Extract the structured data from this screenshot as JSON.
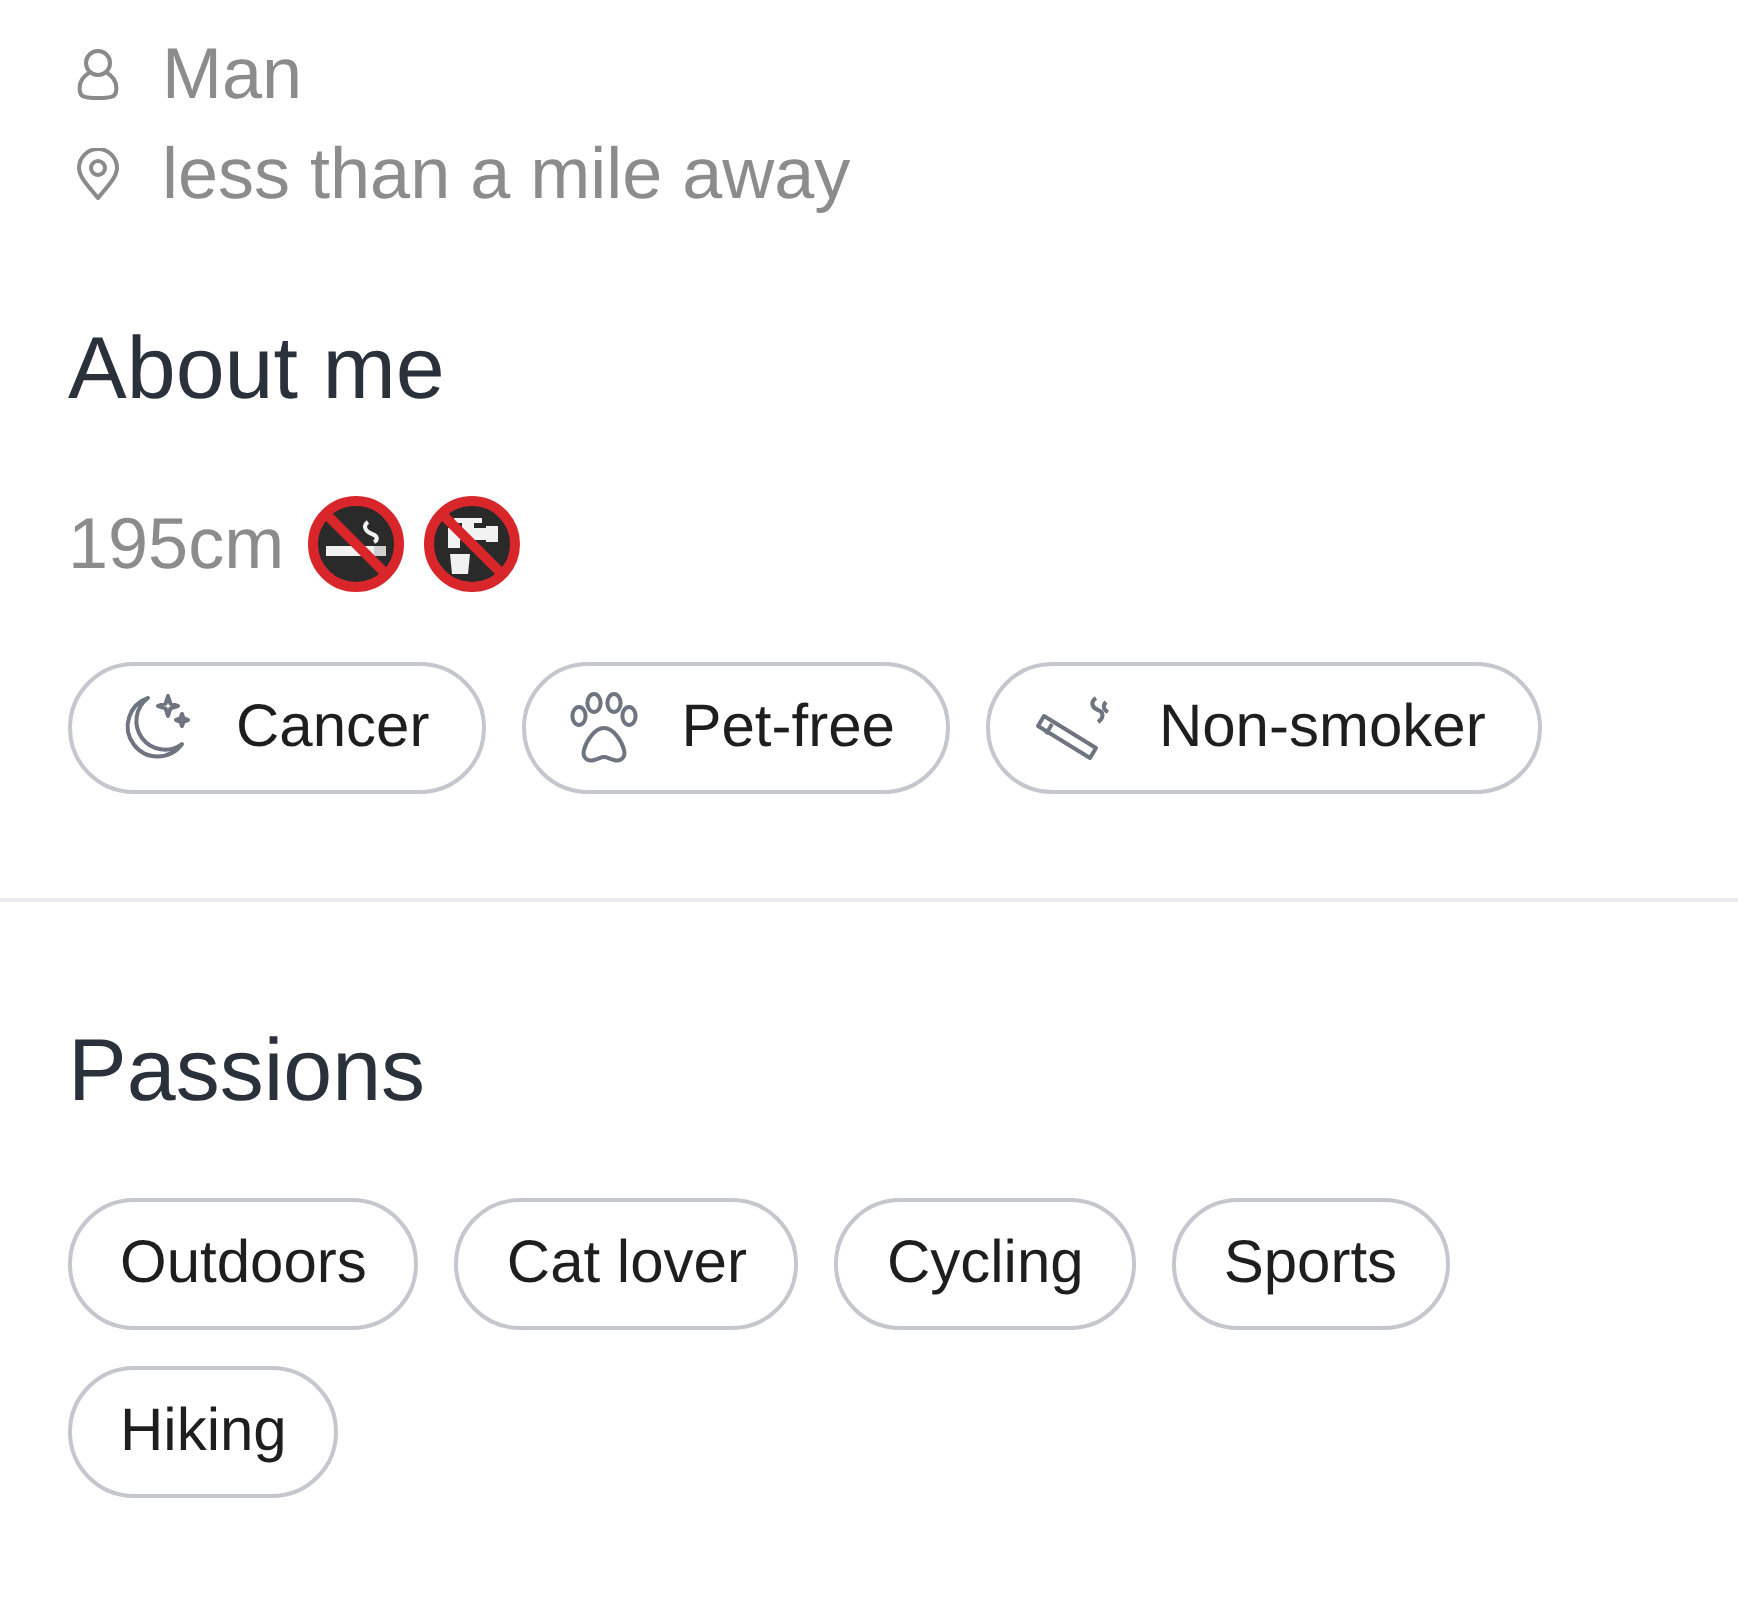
{
  "details": [
    {
      "kind": "gender",
      "text": "Man"
    },
    {
      "kind": "distance",
      "text": "less than a mile away"
    }
  ],
  "about_me": {
    "title": "About me",
    "height": "195cm",
    "badges": [
      {
        "kind": "zodiac",
        "label": "Cancer"
      },
      {
        "kind": "pets",
        "label": "Pet-free"
      },
      {
        "kind": "smoking",
        "label": "Non-smoker"
      }
    ]
  },
  "passions": {
    "title": "Passions",
    "tags": [
      "Outdoors",
      "Cat lover",
      "Cycling",
      "Sports",
      "Hiking"
    ]
  }
}
